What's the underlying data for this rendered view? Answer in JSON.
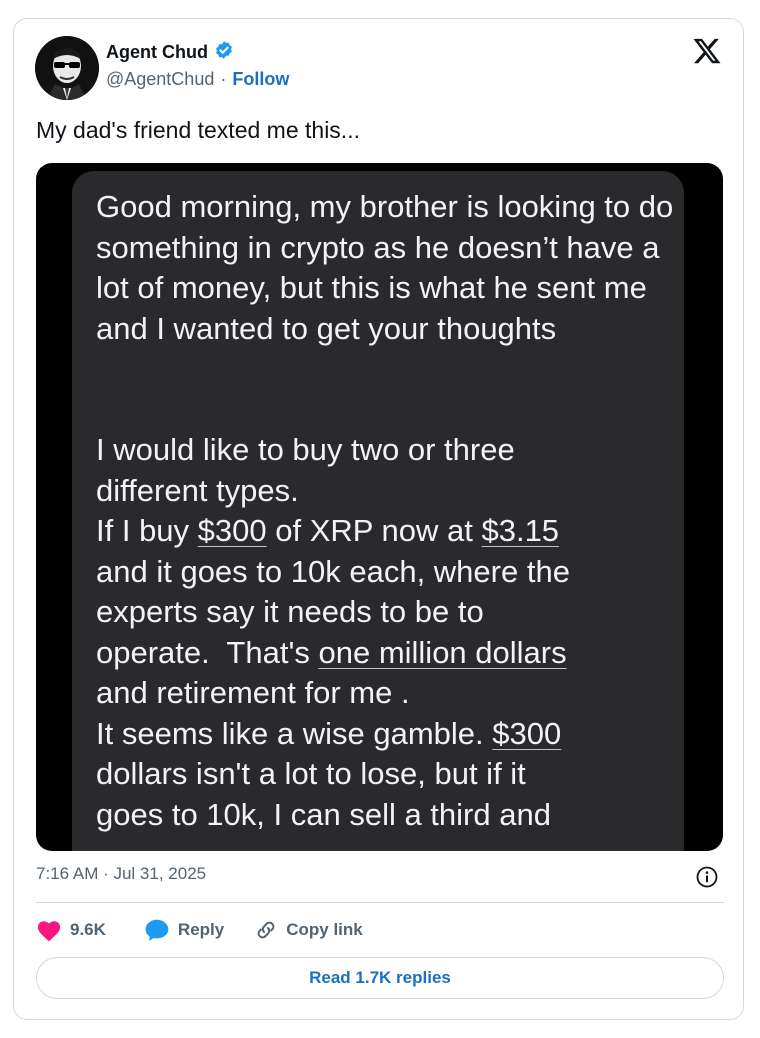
{
  "author": {
    "display_name": "Agent Chud",
    "handle": "@AgentChud",
    "separator": "·",
    "follow_label": "Follow",
    "verified": true
  },
  "tweet": {
    "text": "My dad's friend texted me this...",
    "timestamp": "7:16 AM · Jul 31, 2025"
  },
  "message": {
    "para1": "Good morning, my brother is looking to do something in crypto as he doesn’t have a lot of money, but this is what he sent me and I wanted to get your thoughts",
    "l1": "I would like to buy two or three",
    "l2": "different types.",
    "l3a": "If I buy ",
    "l3b": "$300",
    "l3c": " of XRP now at ",
    "l3d": "$3.15",
    "l4": "and it goes to 10k each, where the",
    "l5": "experts say it needs to be to",
    "l6a": "operate.  That's ",
    "l6b": "one million dollars",
    "l7": "and retirement for me .",
    "l8a": "It seems like a wise gamble. ",
    "l8b": "$300",
    "l9": "dollars isn't a lot to lose, but if it",
    "l10": "goes to 10k, I can sell a third and"
  },
  "actions": {
    "likes": "9.6K",
    "reply": "Reply",
    "copy_link": "Copy link",
    "read_replies": "Read 1.7K replies"
  },
  "colors": {
    "link_blue": "#1d6fbf",
    "heart_red": "#f91880",
    "reply_blue": "#1d9bf0",
    "bubble_gray": "#2a2a2c"
  },
  "icons": [
    "avatar",
    "verified-badge-icon",
    "x-logo-icon",
    "info-icon",
    "heart-icon",
    "reply-bubble-icon",
    "link-icon"
  ]
}
